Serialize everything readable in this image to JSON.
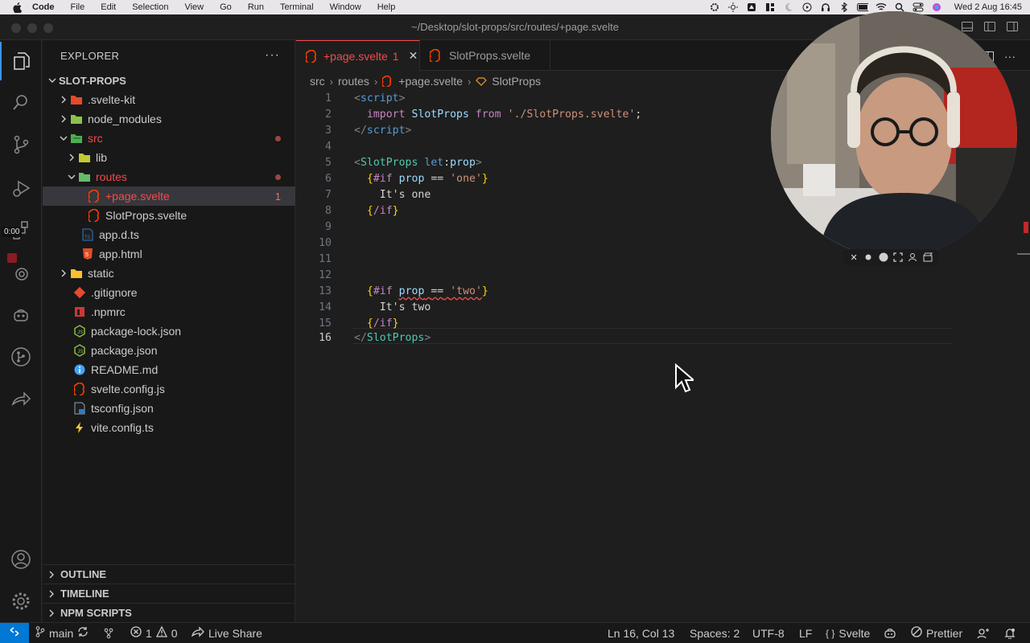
{
  "menubar": {
    "app_name": "Code",
    "items": [
      "File",
      "Edit",
      "Selection",
      "View",
      "Go",
      "Run",
      "Terminal",
      "Window",
      "Help"
    ],
    "clock": "Wed 2 Aug  16:45"
  },
  "window": {
    "title": "~/Desktop/slot-props/src/routes/+page.svelte"
  },
  "recording": {
    "timer": "0:00"
  },
  "explorer": {
    "header": "EXPLORER",
    "more": "···",
    "root": "SLOT-PROPS",
    "items": [
      {
        "label": ".svelte-kit"
      },
      {
        "label": "node_modules"
      },
      {
        "label": "src"
      },
      {
        "label": "lib"
      },
      {
        "label": "routes"
      },
      {
        "label": "+page.svelte",
        "count": "1"
      },
      {
        "label": "SlotProps.svelte"
      },
      {
        "label": "app.d.ts"
      },
      {
        "label": "app.html"
      },
      {
        "label": "static"
      },
      {
        "label": ".gitignore"
      },
      {
        "label": ".npmrc"
      },
      {
        "label": "package-lock.json"
      },
      {
        "label": "package.json"
      },
      {
        "label": "README.md"
      },
      {
        "label": "svelte.config.js"
      },
      {
        "label": "tsconfig.json"
      },
      {
        "label": "vite.config.ts"
      }
    ],
    "panels": [
      "OUTLINE",
      "TIMELINE",
      "NPM SCRIPTS"
    ]
  },
  "tabs": [
    {
      "label": "+page.svelte",
      "badge": "1"
    },
    {
      "label": "SlotProps.svelte"
    }
  ],
  "breadcrumb": [
    "src",
    "routes",
    "+page.svelte",
    "SlotProps"
  ],
  "code": {
    "line_numbers": [
      "1",
      "2",
      "3",
      "4",
      "5",
      "6",
      "7",
      "8",
      "9",
      "10",
      "11",
      "12",
      "13",
      "14",
      "15",
      "16"
    ],
    "current_line": "16"
  },
  "status": {
    "branch": "main",
    "errors": "1",
    "warnings": "0",
    "live_share": "Live Share",
    "position": "Ln 16, Col 13",
    "spaces": "Spaces: 2",
    "encoding": "UTF-8",
    "eol": "LF",
    "language": "Svelte",
    "language_braces": "{ }",
    "prettier": "Prettier"
  },
  "colors": {
    "accent": "#0078d4",
    "svelte": "#ff3e00",
    "error": "#f14c4c"
  }
}
